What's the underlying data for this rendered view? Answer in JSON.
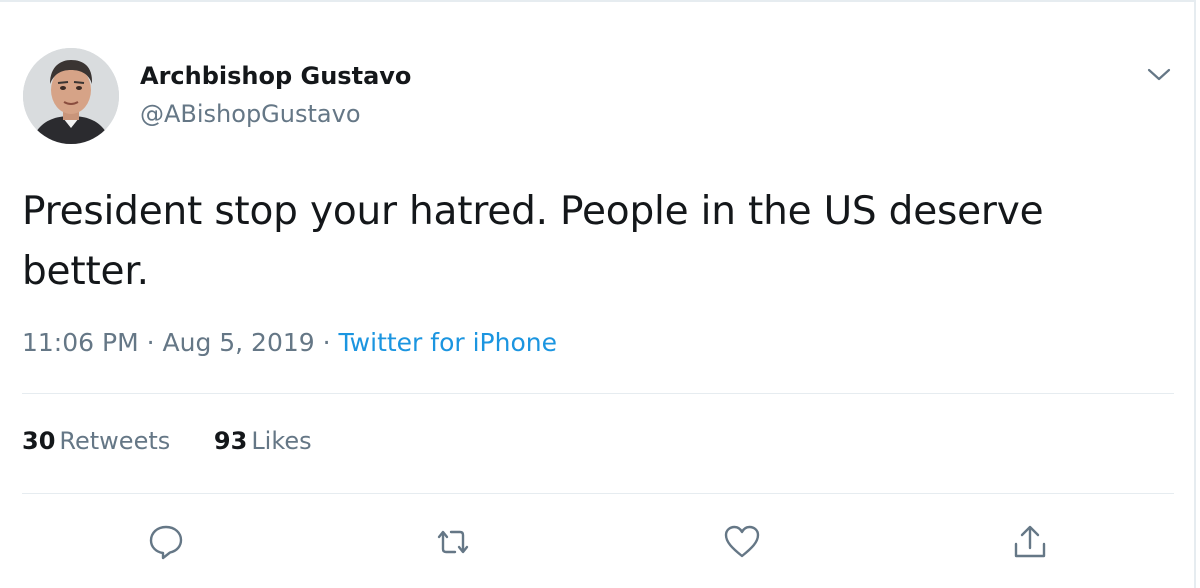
{
  "author": {
    "display_name": "Archbishop Gustavo",
    "handle": "@ABishopGustavo"
  },
  "tweet": {
    "text": "President stop your hatred. People in the US deserve better.",
    "time": "11:06 PM",
    "separator": "·",
    "date": "Aug 5, 2019",
    "source": "Twitter for iPhone"
  },
  "stats": {
    "retweets_count": "30",
    "retweets_label": "Retweets",
    "likes_count": "93",
    "likes_label": "Likes"
  },
  "icons": {
    "menu": "chevron-down-icon",
    "reply": "reply-icon",
    "retweet": "retweet-icon",
    "like": "heart-icon",
    "share": "share-icon"
  },
  "colors": {
    "text": "#14171a",
    "secondary": "#657786",
    "link": "#1b95e0",
    "divider": "#e6ecf0"
  }
}
